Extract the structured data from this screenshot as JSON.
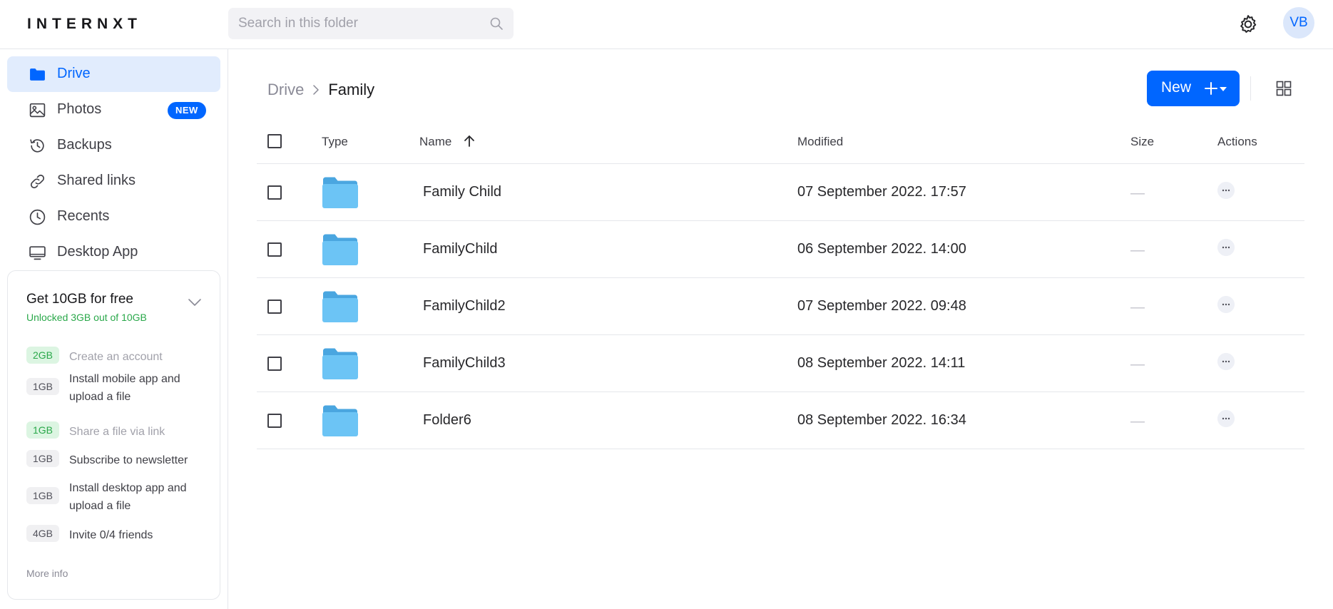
{
  "header": {
    "logo": "INTERNXT",
    "search_placeholder": "Search in this folder",
    "avatar_initials": "VB"
  },
  "sidebar": {
    "items": [
      {
        "label": "Drive",
        "icon": "folder-icon",
        "active": true
      },
      {
        "label": "Photos",
        "icon": "image-icon",
        "badge": "NEW"
      },
      {
        "label": "Backups",
        "icon": "history-icon"
      },
      {
        "label": "Shared links",
        "icon": "link-icon"
      },
      {
        "label": "Recents",
        "icon": "clock-icon"
      },
      {
        "label": "Desktop App",
        "icon": "monitor-icon"
      }
    ],
    "promo": {
      "title": "Get 10GB for free",
      "subtitle": "Unlocked 3GB out of 10GB",
      "tasks": [
        {
          "gb": "2GB",
          "label": "Create an account",
          "done": true
        },
        {
          "gb": "1GB",
          "label": "Install mobile app and upload a file",
          "done": false
        },
        {
          "gb": "1GB",
          "label": "Share a file via link",
          "done": true
        },
        {
          "gb": "1GB",
          "label": "Subscribe to newsletter",
          "done": false
        },
        {
          "gb": "1GB",
          "label": "Install desktop app and upload a file",
          "done": false
        },
        {
          "gb": "4GB",
          "label": "Invite 0/4 friends",
          "done": false
        }
      ],
      "more_info": "More info"
    }
  },
  "main": {
    "breadcrumb": {
      "root": "Drive",
      "current": "Family"
    },
    "new_button": "New",
    "columns": {
      "type": "Type",
      "name": "Name",
      "modified": "Modified",
      "size": "Size",
      "actions": "Actions"
    },
    "rows": [
      {
        "name": "Family Child",
        "modified": "07 September 2022. 17:57",
        "size": "—"
      },
      {
        "name": "FamilyChild",
        "modified": "06 September 2022. 14:00",
        "size": "—"
      },
      {
        "name": "FamilyChild2",
        "modified": "07 September 2022. 09:48",
        "size": "—"
      },
      {
        "name": "FamilyChild3",
        "modified": "08 September 2022. 14:11",
        "size": "—"
      },
      {
        "name": "Folder6",
        "modified": "08 September 2022. 16:34",
        "size": "—"
      }
    ]
  },
  "colors": {
    "accent": "#0066ff",
    "active_bg": "#e1ecfd",
    "success": "#2aa84a",
    "folder": "#5ab4ec"
  }
}
